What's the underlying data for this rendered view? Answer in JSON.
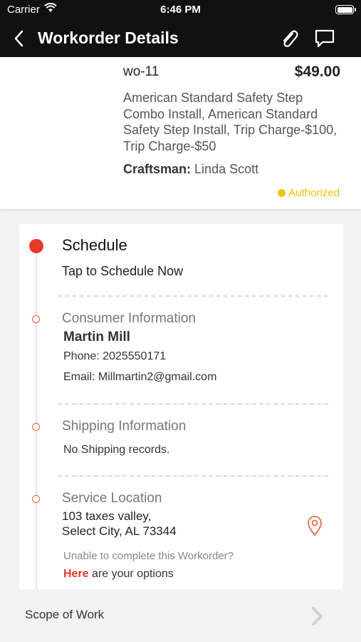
{
  "status_bar": {
    "carrier": "Carrier",
    "time": "6:46 PM"
  },
  "nav": {
    "title": "Workorder Details"
  },
  "workorder": {
    "id": "wo-11",
    "price": "$49.00",
    "description": "American Standard Safety Step Combo Install, American Standard Safety Step Install, Trip Charge-$100, Trip Charge-$50",
    "craftsman_label": "Craftsman:",
    "craftsman_name": "Linda Scott",
    "status": "Authorized"
  },
  "schedule": {
    "title": "Schedule",
    "action": "Tap to Schedule Now"
  },
  "consumer": {
    "heading": "Consumer Information",
    "name": "Martin Mill",
    "phone": "Phone: 2025550171",
    "email": "Email: Millmartin2@gmail.com"
  },
  "shipping": {
    "heading": "Shipping Information",
    "message": "No Shipping records."
  },
  "service_location": {
    "heading": "Service Location",
    "address_line1": "103 taxes valley,",
    "address_line2": "Select City, AL 73344",
    "unable_text": "Unable to complete this Workorder?",
    "here_link": "Here",
    "options_text": " are your options"
  },
  "scope": {
    "label": "Scope of Work"
  },
  "colors": {
    "accent": "#e8392b",
    "authorized": "#f4c20d",
    "header": "#111111"
  }
}
